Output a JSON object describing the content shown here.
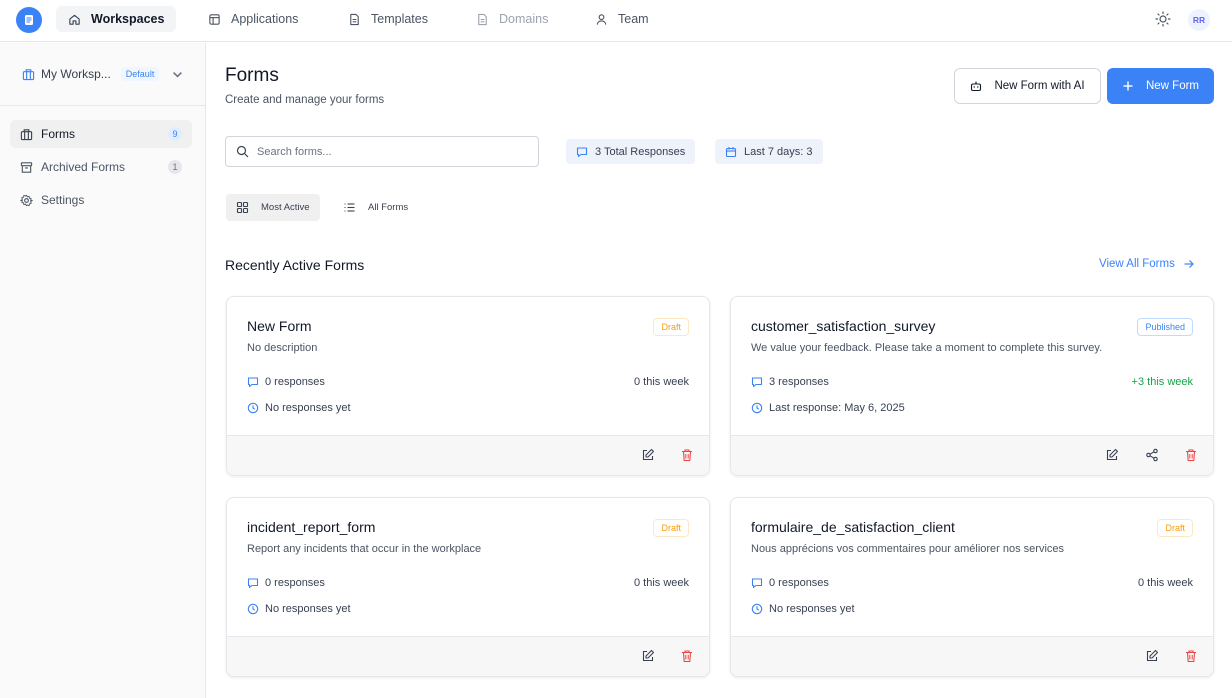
{
  "nav": {
    "items": [
      {
        "label": "Workspaces"
      },
      {
        "label": "Applications"
      },
      {
        "label": "Templates"
      },
      {
        "label": "Domains"
      },
      {
        "label": "Team"
      }
    ],
    "avatar_initials": "RR"
  },
  "sidebar": {
    "workspace_name": "My Worksp...",
    "workspace_badge": "Default",
    "items": [
      {
        "label": "Forms",
        "count": "9"
      },
      {
        "label": "Archived Forms",
        "count": "1"
      },
      {
        "label": "Settings"
      }
    ]
  },
  "header": {
    "title": "Forms",
    "subtitle": "Create and manage your forms",
    "ai_button_label": "New Form with AI",
    "new_button_label": "New Form"
  },
  "toolbar": {
    "search_placeholder": "Search forms...",
    "total_responses": "3 Total Responses",
    "last_7_days": "Last 7 days: 3",
    "view_most_active": "Most Active",
    "view_all_forms": "All Forms"
  },
  "section": {
    "title": "Recently Active Forms",
    "view_all": "View All Forms"
  },
  "forms": [
    {
      "title": "New Form",
      "description": "No description",
      "status": "Draft",
      "responses": "0 responses",
      "week": "0 this week",
      "last": "No responses yet"
    },
    {
      "title": "customer_satisfaction_survey",
      "description": "We value your feedback. Please take a moment to complete this survey.",
      "status": "Published",
      "responses": "3 responses",
      "week": "+3 this week",
      "last": "Last response: May 6, 2025"
    },
    {
      "title": "incident_report_form",
      "description": "Report any incidents that occur in the workplace",
      "status": "Draft",
      "responses": "0 responses",
      "week": "0 this week",
      "last": "No responses yet"
    },
    {
      "title": "formulaire_de_satisfaction_client",
      "description": "Nous apprécions vos commentaires pour améliorer nos services",
      "status": "Draft",
      "responses": "0 responses",
      "week": "0 this week",
      "last": "No responses yet"
    }
  ],
  "colors": {
    "accent": "#3b82f6",
    "draft": "#f59e0b",
    "published": "#3b82f6",
    "positive": "#16a34a",
    "delete": "#ef4444"
  }
}
